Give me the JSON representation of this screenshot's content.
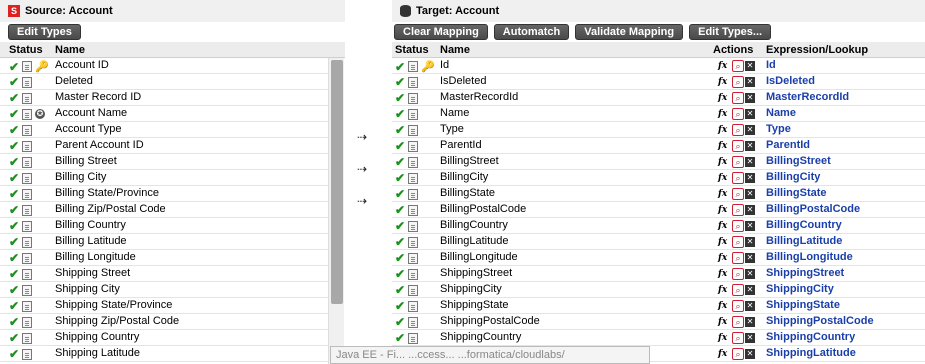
{
  "source": {
    "title": "Source: Account",
    "edit_types": "Edit Types",
    "col_status": "Status",
    "col_name": "Name",
    "rows": [
      {
        "name": "Account ID",
        "key": true,
        "star": false
      },
      {
        "name": "Deleted",
        "key": false,
        "star": false
      },
      {
        "name": "Master Record ID",
        "key": false,
        "star": false
      },
      {
        "name": "Account Name",
        "key": false,
        "star": true
      },
      {
        "name": "Account Type",
        "key": false,
        "star": false
      },
      {
        "name": "Parent Account ID",
        "key": false,
        "star": false
      },
      {
        "name": "Billing Street",
        "key": false,
        "star": false
      },
      {
        "name": "Billing City",
        "key": false,
        "star": false
      },
      {
        "name": "Billing State/Province",
        "key": false,
        "star": false
      },
      {
        "name": "Billing Zip/Postal Code",
        "key": false,
        "star": false
      },
      {
        "name": "Billing Country",
        "key": false,
        "star": false
      },
      {
        "name": "Billing Latitude",
        "key": false,
        "star": false
      },
      {
        "name": "Billing Longitude",
        "key": false,
        "star": false
      },
      {
        "name": "Shipping Street",
        "key": false,
        "star": false
      },
      {
        "name": "Shipping City",
        "key": false,
        "star": false
      },
      {
        "name": "Shipping State/Province",
        "key": false,
        "star": false
      },
      {
        "name": "Shipping Zip/Postal Code",
        "key": false,
        "star": false
      },
      {
        "name": "Shipping Country",
        "key": false,
        "star": false
      },
      {
        "name": "Shipping Latitude",
        "key": false,
        "star": false
      }
    ]
  },
  "target": {
    "title": "Target: Account",
    "buttons": {
      "clear_mapping": "Clear Mapping",
      "automatch": "Automatch",
      "validate_mapping": "Validate Mapping",
      "edit_types": "Edit Types..."
    },
    "col_status": "Status",
    "col_name": "Name",
    "col_actions": "Actions",
    "col_expression": "Expression/Lookup",
    "rows": [
      {
        "name": "Id",
        "expr": "Id",
        "key": true
      },
      {
        "name": "IsDeleted",
        "expr": "IsDeleted",
        "key": false
      },
      {
        "name": "MasterRecordId",
        "expr": "MasterRecordId",
        "key": false
      },
      {
        "name": "Name",
        "expr": "Name",
        "key": false
      },
      {
        "name": "Type",
        "expr": "Type",
        "key": false
      },
      {
        "name": "ParentId",
        "expr": "ParentId",
        "key": false
      },
      {
        "name": "BillingStreet",
        "expr": "BillingStreet",
        "key": false
      },
      {
        "name": "BillingCity",
        "expr": "BillingCity",
        "key": false
      },
      {
        "name": "BillingState",
        "expr": "BillingState",
        "key": false
      },
      {
        "name": "BillingPostalCode",
        "expr": "BillingPostalCode",
        "key": false
      },
      {
        "name": "BillingCountry",
        "expr": "BillingCountry",
        "key": false
      },
      {
        "name": "BillingLatitude",
        "expr": "BillingLatitude",
        "key": false
      },
      {
        "name": "BillingLongitude",
        "expr": "BillingLongitude",
        "key": false
      },
      {
        "name": "ShippingStreet",
        "expr": "ShippingStreet",
        "key": false
      },
      {
        "name": "ShippingCity",
        "expr": "ShippingCity",
        "key": false
      },
      {
        "name": "ShippingState",
        "expr": "ShippingState",
        "key": false
      },
      {
        "name": "ShippingPostalCode",
        "expr": "ShippingPostalCode",
        "key": false
      },
      {
        "name": "ShippingCountry",
        "expr": "ShippingCountry",
        "key": false
      },
      {
        "name": "ShippingLatitude",
        "expr": "ShippingLatitude",
        "key": false
      }
    ]
  },
  "mapping_arrows": "⇢",
  "status_tooltip": "Java EE - Fi... ...ccess... ...formatica/cloudlabs/",
  "icons": {
    "check": "✔",
    "key": "🔑",
    "star": "✪",
    "fx": "fx",
    "lookup": "⌕",
    "delete": "✕"
  },
  "colors": {
    "expression_text": "#1a3faa",
    "check": "#1f8f1f",
    "button_bg": "#555555"
  }
}
